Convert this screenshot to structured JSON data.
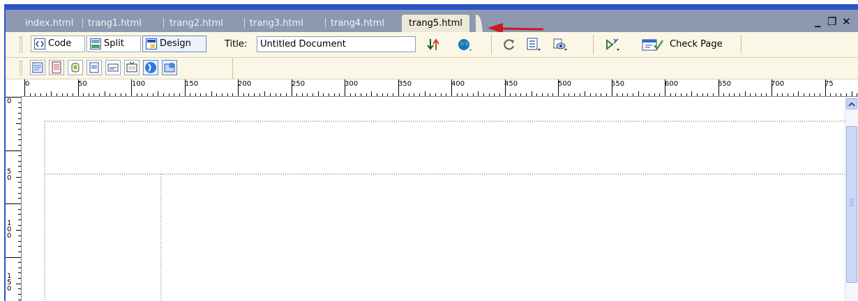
{
  "tabs": [
    {
      "label": "index.html",
      "active": false
    },
    {
      "label": "trang1.html",
      "active": false
    },
    {
      "label": "trang2.html",
      "active": false
    },
    {
      "label": "trang3.html",
      "active": false
    },
    {
      "label": "trang4.html",
      "active": false
    },
    {
      "label": "trang5.html",
      "active": true
    }
  ],
  "window_controls": {
    "minimize": "_",
    "restore": "❐",
    "close": "✕"
  },
  "toolbar": {
    "code_label": "Code",
    "split_label": "Split",
    "design_label": "Design",
    "title_label": "Title:",
    "title_value": "Untitled Document",
    "check_page_label": "Check Page"
  },
  "ruler_h_labels": [
    "0",
    "50",
    "100",
    "150",
    "200",
    "250",
    "300",
    "350",
    "400",
    "450",
    "500",
    "550",
    "600",
    "650",
    "700",
    "75"
  ],
  "ruler_v_labels": [
    "0",
    "50",
    "100",
    "150"
  ],
  "colors": {
    "tab_bar": "#8c99b0",
    "toolbar_bg": "#fbf7e6",
    "window_border": "#2d53c9",
    "arrow": "#cc1a1a"
  },
  "icons": {
    "file_management": "file-management-icon",
    "preview": "preview-globe-icon",
    "refresh": "refresh-icon",
    "view_options": "view-options-icon",
    "visual_aids": "visual-aids-icon",
    "validate": "validate-markup-icon",
    "check_page": "check-page-icon"
  }
}
